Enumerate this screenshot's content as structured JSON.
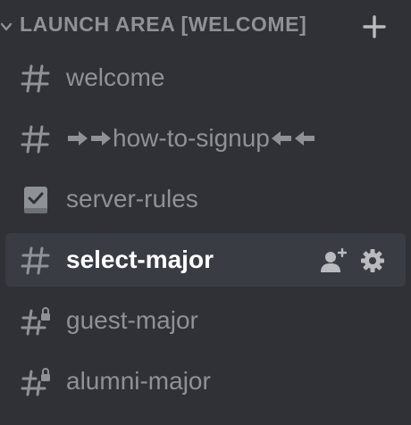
{
  "category": {
    "label": "LAUNCH AREA [WELCOME]",
    "collapse_icon": "chevron-down-icon",
    "add_icon": "plus-icon"
  },
  "channels": [
    {
      "name": "welcome",
      "icon": "hash-icon"
    },
    {
      "name_core": "how-to-signup",
      "icon": "hash-icon",
      "prefix_icons": [
        "arrow-right-icon",
        "arrow-right-icon"
      ],
      "suffix_icons": [
        "arrow-left-icon",
        "arrow-left-icon"
      ]
    },
    {
      "name": "server-rules",
      "icon": "rules-book-icon"
    },
    {
      "name": "select-major",
      "icon": "hash-icon",
      "selected": true,
      "action_icons": [
        "invite-user-icon",
        "settings-gear-icon"
      ]
    },
    {
      "name": "guest-major",
      "icon": "locked-hash-icon"
    },
    {
      "name": "alumni-major",
      "icon": "locked-hash-icon"
    }
  ],
  "colors": {
    "background": "#2f3136",
    "muted_text": "#8e9297",
    "selected_bg": "#393c43",
    "selected_text": "#ffffff"
  }
}
